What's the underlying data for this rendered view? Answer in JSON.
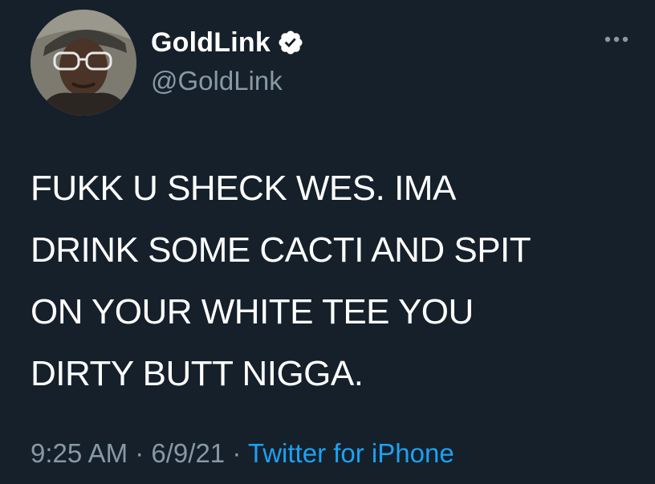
{
  "user": {
    "display_name": "GoldLink",
    "handle": "@GoldLink",
    "verified": true
  },
  "tweet": {
    "lines": [
      "FUKK U SHECK WES. IMA",
      "DRINK SOME CACTI AND SPIT",
      "ON YOUR WHITE TEE YOU",
      "DIRTY BUTT NIGGA."
    ]
  },
  "meta": {
    "time": "9:25 AM",
    "separator": " · ",
    "date": "6/9/21",
    "source": "Twitter for iPhone"
  },
  "icons": {
    "verified": "verified-badge-icon",
    "more": "more-options-icon"
  },
  "colors": {
    "background": "#15202b",
    "secondary_text": "#8899a6",
    "link": "#1da1f2"
  }
}
